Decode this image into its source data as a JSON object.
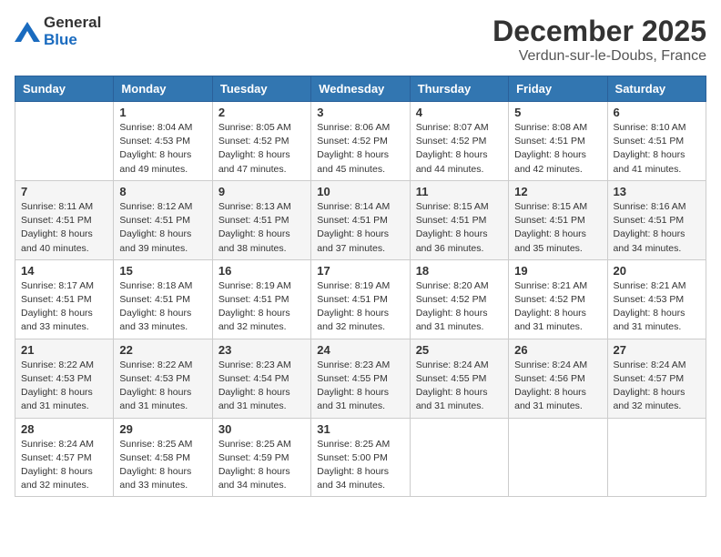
{
  "header": {
    "logo_general": "General",
    "logo_blue": "Blue",
    "month_year": "December 2025",
    "location": "Verdun-sur-le-Doubs, France"
  },
  "weekdays": [
    "Sunday",
    "Monday",
    "Tuesday",
    "Wednesday",
    "Thursday",
    "Friday",
    "Saturday"
  ],
  "weeks": [
    [
      {
        "day": "",
        "info": ""
      },
      {
        "day": "1",
        "info": "Sunrise: 8:04 AM\nSunset: 4:53 PM\nDaylight: 8 hours\nand 49 minutes."
      },
      {
        "day": "2",
        "info": "Sunrise: 8:05 AM\nSunset: 4:52 PM\nDaylight: 8 hours\nand 47 minutes."
      },
      {
        "day": "3",
        "info": "Sunrise: 8:06 AM\nSunset: 4:52 PM\nDaylight: 8 hours\nand 45 minutes."
      },
      {
        "day": "4",
        "info": "Sunrise: 8:07 AM\nSunset: 4:52 PM\nDaylight: 8 hours\nand 44 minutes."
      },
      {
        "day": "5",
        "info": "Sunrise: 8:08 AM\nSunset: 4:51 PM\nDaylight: 8 hours\nand 42 minutes."
      },
      {
        "day": "6",
        "info": "Sunrise: 8:10 AM\nSunset: 4:51 PM\nDaylight: 8 hours\nand 41 minutes."
      }
    ],
    [
      {
        "day": "7",
        "info": "Sunrise: 8:11 AM\nSunset: 4:51 PM\nDaylight: 8 hours\nand 40 minutes."
      },
      {
        "day": "8",
        "info": "Sunrise: 8:12 AM\nSunset: 4:51 PM\nDaylight: 8 hours\nand 39 minutes."
      },
      {
        "day": "9",
        "info": "Sunrise: 8:13 AM\nSunset: 4:51 PM\nDaylight: 8 hours\nand 38 minutes."
      },
      {
        "day": "10",
        "info": "Sunrise: 8:14 AM\nSunset: 4:51 PM\nDaylight: 8 hours\nand 37 minutes."
      },
      {
        "day": "11",
        "info": "Sunrise: 8:15 AM\nSunset: 4:51 PM\nDaylight: 8 hours\nand 36 minutes."
      },
      {
        "day": "12",
        "info": "Sunrise: 8:15 AM\nSunset: 4:51 PM\nDaylight: 8 hours\nand 35 minutes."
      },
      {
        "day": "13",
        "info": "Sunrise: 8:16 AM\nSunset: 4:51 PM\nDaylight: 8 hours\nand 34 minutes."
      }
    ],
    [
      {
        "day": "14",
        "info": "Sunrise: 8:17 AM\nSunset: 4:51 PM\nDaylight: 8 hours\nand 33 minutes."
      },
      {
        "day": "15",
        "info": "Sunrise: 8:18 AM\nSunset: 4:51 PM\nDaylight: 8 hours\nand 33 minutes."
      },
      {
        "day": "16",
        "info": "Sunrise: 8:19 AM\nSunset: 4:51 PM\nDaylight: 8 hours\nand 32 minutes."
      },
      {
        "day": "17",
        "info": "Sunrise: 8:19 AM\nSunset: 4:51 PM\nDaylight: 8 hours\nand 32 minutes."
      },
      {
        "day": "18",
        "info": "Sunrise: 8:20 AM\nSunset: 4:52 PM\nDaylight: 8 hours\nand 31 minutes."
      },
      {
        "day": "19",
        "info": "Sunrise: 8:21 AM\nSunset: 4:52 PM\nDaylight: 8 hours\nand 31 minutes."
      },
      {
        "day": "20",
        "info": "Sunrise: 8:21 AM\nSunset: 4:53 PM\nDaylight: 8 hours\nand 31 minutes."
      }
    ],
    [
      {
        "day": "21",
        "info": "Sunrise: 8:22 AM\nSunset: 4:53 PM\nDaylight: 8 hours\nand 31 minutes."
      },
      {
        "day": "22",
        "info": "Sunrise: 8:22 AM\nSunset: 4:53 PM\nDaylight: 8 hours\nand 31 minutes."
      },
      {
        "day": "23",
        "info": "Sunrise: 8:23 AM\nSunset: 4:54 PM\nDaylight: 8 hours\nand 31 minutes."
      },
      {
        "day": "24",
        "info": "Sunrise: 8:23 AM\nSunset: 4:55 PM\nDaylight: 8 hours\nand 31 minutes."
      },
      {
        "day": "25",
        "info": "Sunrise: 8:24 AM\nSunset: 4:55 PM\nDaylight: 8 hours\nand 31 minutes."
      },
      {
        "day": "26",
        "info": "Sunrise: 8:24 AM\nSunset: 4:56 PM\nDaylight: 8 hours\nand 31 minutes."
      },
      {
        "day": "27",
        "info": "Sunrise: 8:24 AM\nSunset: 4:57 PM\nDaylight: 8 hours\nand 32 minutes."
      }
    ],
    [
      {
        "day": "28",
        "info": "Sunrise: 8:24 AM\nSunset: 4:57 PM\nDaylight: 8 hours\nand 32 minutes."
      },
      {
        "day": "29",
        "info": "Sunrise: 8:25 AM\nSunset: 4:58 PM\nDaylight: 8 hours\nand 33 minutes."
      },
      {
        "day": "30",
        "info": "Sunrise: 8:25 AM\nSunset: 4:59 PM\nDaylight: 8 hours\nand 34 minutes."
      },
      {
        "day": "31",
        "info": "Sunrise: 8:25 AM\nSunset: 5:00 PM\nDaylight: 8 hours\nand 34 minutes."
      },
      {
        "day": "",
        "info": ""
      },
      {
        "day": "",
        "info": ""
      },
      {
        "day": "",
        "info": ""
      }
    ]
  ]
}
